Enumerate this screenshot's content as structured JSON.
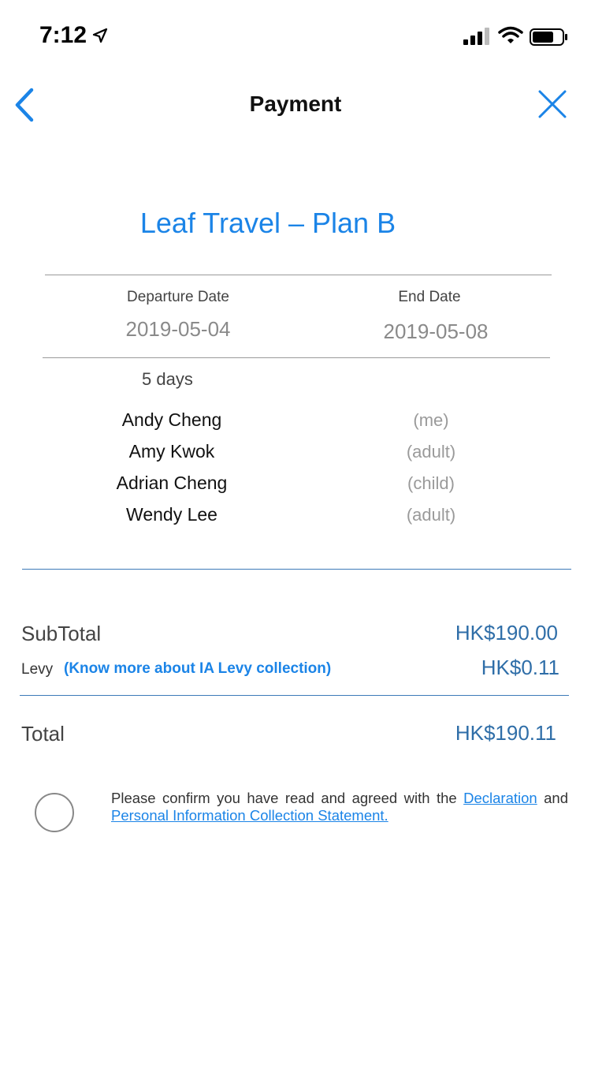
{
  "status_bar": {
    "time": "7:12"
  },
  "nav": {
    "title": "Payment"
  },
  "plan": {
    "title": "Leaf Travel – Plan B"
  },
  "dates": {
    "departure_label": "Departure Date",
    "departure_value": "2019-05-04",
    "end_label": "End Date",
    "end_value": "2019-05-08",
    "duration": "5 days"
  },
  "travellers": [
    {
      "name": "Andy Cheng",
      "role": "(me)"
    },
    {
      "name": "Amy Kwok",
      "role": "(adult)"
    },
    {
      "name": "Adrian Cheng",
      "role": "(child)"
    },
    {
      "name": "Wendy Lee",
      "role": "(adult)"
    }
  ],
  "summary": {
    "subtotal_label": "SubTotal",
    "subtotal_value": "HK$190.00",
    "levy_label": "Levy",
    "levy_link": "(Know more about IA Levy collection)",
    "levy_value": "HK$0.11",
    "total_label": "Total",
    "total_value": "HK$190.11"
  },
  "declaration": {
    "text_before": "Please confirm you have read and agreed with the ",
    "declaration_link": "Declaration",
    "text_and": " and ",
    "pics_link": "Personal Information Collection Statement."
  },
  "colors": {
    "accent": "#1b84e7",
    "amount": "#2f6ea8"
  }
}
